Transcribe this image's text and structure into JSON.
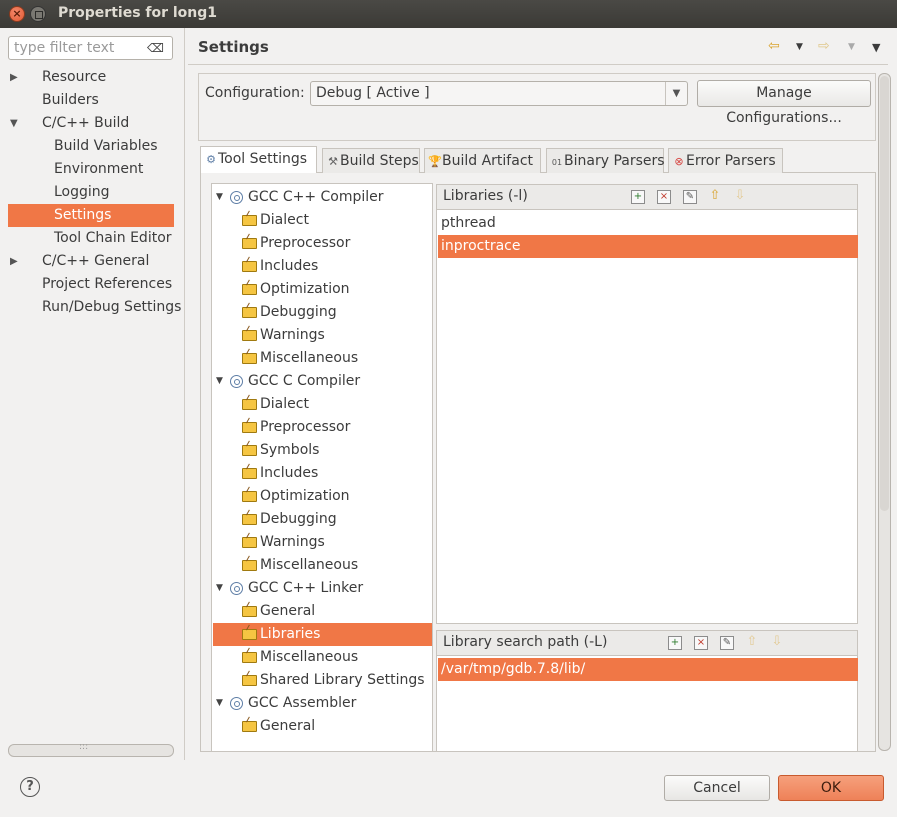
{
  "window": {
    "title": "Properties for long1"
  },
  "filter": {
    "placeholder": "type filter text"
  },
  "nav": {
    "items": [
      {
        "label": "Resource",
        "expanded": false,
        "children": true
      },
      {
        "label": "Builders"
      },
      {
        "label": "C/C++ Build",
        "expanded": true,
        "children": true
      },
      {
        "label": "Build Variables"
      },
      {
        "label": "Environment"
      },
      {
        "label": "Logging"
      },
      {
        "label": "Settings",
        "selected": true
      },
      {
        "label": "Tool Chain Editor"
      },
      {
        "label": "C/C++ General",
        "expanded": false,
        "children": true
      },
      {
        "label": "Project References"
      },
      {
        "label": "Run/Debug Settings"
      }
    ]
  },
  "page": {
    "heading": "Settings"
  },
  "config": {
    "label": "Configuration:",
    "value": "Debug  [ Active ]",
    "manage_label": "Manage Configurations..."
  },
  "tabs": [
    {
      "label": "Tool Settings",
      "active": true,
      "icon": "tool-settings-icon"
    },
    {
      "label": "Build Steps",
      "icon": "build-steps-icon"
    },
    {
      "label": "Build Artifact",
      "icon": "build-artifact-icon"
    },
    {
      "label": "Binary Parsers",
      "icon": "binary-parsers-icon"
    },
    {
      "label": "Error Parsers",
      "icon": "error-parsers-icon"
    }
  ],
  "tree": [
    {
      "label": "GCC C++ Compiler",
      "tool": true
    },
    {
      "label": "Dialect"
    },
    {
      "label": "Preprocessor"
    },
    {
      "label": "Includes"
    },
    {
      "label": "Optimization"
    },
    {
      "label": "Debugging"
    },
    {
      "label": "Warnings"
    },
    {
      "label": "Miscellaneous"
    },
    {
      "label": "GCC C Compiler",
      "tool": true
    },
    {
      "label": "Dialect"
    },
    {
      "label": "Preprocessor"
    },
    {
      "label": "Symbols"
    },
    {
      "label": "Includes"
    },
    {
      "label": "Optimization"
    },
    {
      "label": "Debugging"
    },
    {
      "label": "Warnings"
    },
    {
      "label": "Miscellaneous"
    },
    {
      "label": "GCC C++ Linker",
      "tool": true
    },
    {
      "label": "General"
    },
    {
      "label": "Libraries",
      "selected": true
    },
    {
      "label": "Miscellaneous"
    },
    {
      "label": "Shared Library Settings"
    },
    {
      "label": "GCC Assembler",
      "tool": true
    },
    {
      "label": "General"
    }
  ],
  "libraries": {
    "title": "Libraries (-l)",
    "items": [
      "pthread",
      "inproctrace"
    ],
    "selected_index": 1
  },
  "libpaths": {
    "title": "Library search path (-L)",
    "items": [
      "/var/tmp/gdb.7.8/lib/"
    ],
    "selected_index": 0
  },
  "buttons": {
    "cancel": "Cancel",
    "ok": "OK"
  },
  "colors": {
    "selection": "#f07746",
    "titlebar": "#3c3b37",
    "ok_button": "#ef8a60"
  }
}
